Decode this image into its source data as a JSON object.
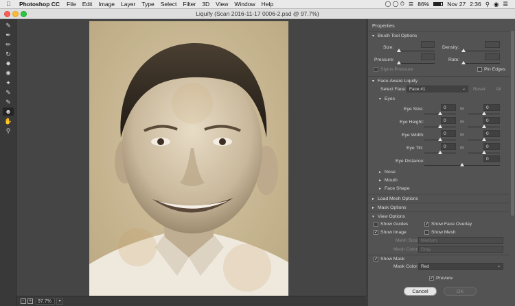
{
  "menubar": {
    "app_name": "Photoshop CC",
    "items": [
      "File",
      "Edit",
      "Image",
      "Layer",
      "Type",
      "Select",
      "Filter",
      "3D",
      "View",
      "Window",
      "Help"
    ],
    "battery": "86%",
    "date": "Nov 27",
    "time": "2:36"
  },
  "window": {
    "title": "Liquify (Scan 2016-11-17 0006-2.psd @ 97.7%)"
  },
  "status": {
    "zoom": "97.7%"
  },
  "panel": {
    "title": "Properties",
    "brush": {
      "header": "Brush Tool Options",
      "size_label": "Size:",
      "density_label": "Density:",
      "pressure_label": "Pressure:",
      "rate_label": "Rate:",
      "stylus_label": "Stylus Pressure",
      "pin_edges_label": "Pin Edges"
    },
    "face": {
      "header": "Face-Aware Liquify",
      "select_face_label": "Select Face:",
      "select_face_value": "Face #1",
      "reset_label": "Reset",
      "all_label": "All",
      "eyes_header": "Eyes",
      "eye_size_label": "Eye Size:",
      "eye_size_left": "0",
      "eye_size_right": "0",
      "eye_height_label": "Eye Height:",
      "eye_height_left": "0",
      "eye_height_right": "0",
      "eye_width_label": "Eye Width:",
      "eye_width_left": "0",
      "eye_width_right": "0",
      "eye_tilt_label": "Eye Tilt:",
      "eye_tilt_left": "0",
      "eye_tilt_right": "0",
      "eye_distance_label": "Eye Distance:",
      "eye_distance_value": "0",
      "nose_label": "Nose",
      "mouth_label": "Mouth",
      "face_shape_label": "Face Shape"
    },
    "load_mesh_header": "Load Mesh Options",
    "mask_options_header": "Mask Options",
    "view": {
      "header": "View Options",
      "show_guides_label": "Show Guides",
      "show_face_overlay_label": "Show Face Overlay",
      "show_image_label": "Show Image",
      "show_mesh_label": "Show Mesh",
      "mesh_size_label": "Mesh Size:",
      "mesh_size_value": "Medium",
      "mesh_color_label": "Mesh Color:",
      "mesh_color_value": "Gray",
      "show_mask_label": "Show Mask",
      "mask_color_label": "Mask Color:",
      "mask_color_value": "Red"
    },
    "preview_label": "Preview",
    "cancel_label": "Cancel",
    "ok_label": "OK"
  },
  "icons": [
    "apple-icon",
    "forward-warp-icon",
    "reconstruct-icon",
    "smooth-icon",
    "twirl-icon",
    "pucker-icon",
    "bloat-icon",
    "push-left-icon",
    "freeze-mask-icon",
    "thaw-mask-icon",
    "face-tool-icon",
    "hand-icon",
    "zoom-icon",
    "wifi-icon",
    "battery-icon",
    "search-icon",
    "siri-icon",
    "notification-icon",
    "chain-link-icon"
  ]
}
